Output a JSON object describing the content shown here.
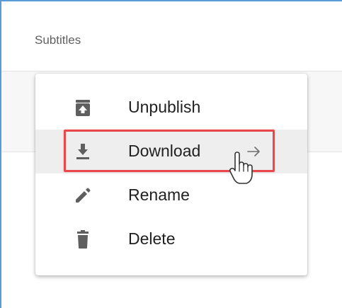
{
  "panel": {
    "title": "Subtitles"
  },
  "menu": {
    "items": [
      {
        "label": "Unpublish",
        "icon": "unpublish-icon"
      },
      {
        "label": "Download",
        "icon": "download-icon",
        "state": "hovered-highlighted"
      },
      {
        "label": "Rename",
        "icon": "pencil-icon"
      },
      {
        "label": "Delete",
        "icon": "trash-icon"
      }
    ]
  },
  "colors": {
    "icon": "#5f5f5f",
    "highlight_border": "#e8474c",
    "window_border": "#5b9bd5",
    "hover_bg": "#eeeeee"
  },
  "overlay": {
    "arrow_icon": "arrow-right-icon",
    "cursor_icon": "hand-pointer-icon"
  }
}
